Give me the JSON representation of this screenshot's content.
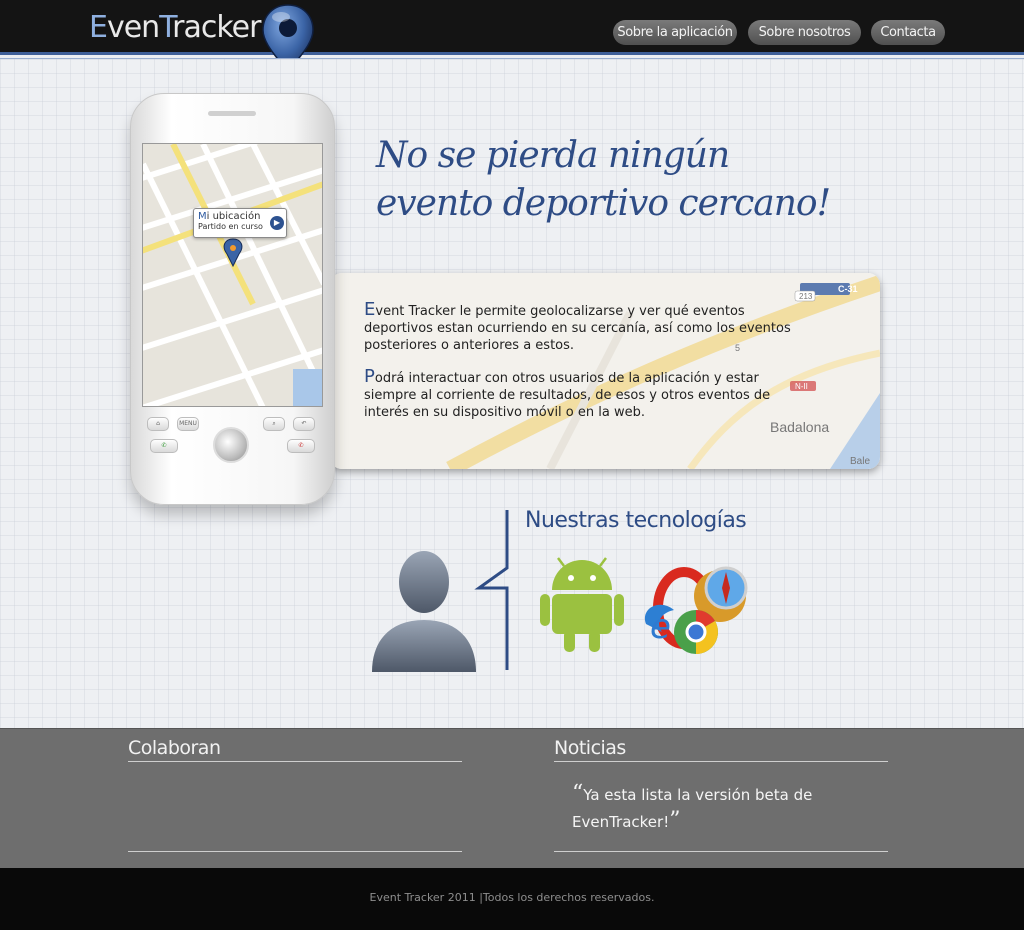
{
  "header": {
    "logo_prefix": "E",
    "logo_mid": "ven",
    "logo_t": "T",
    "logo_suffix": "racker",
    "logo_icon": "map-pin-icon",
    "nav": [
      {
        "label": "Sobre la aplicación"
      },
      {
        "label": "Sobre nosotros"
      },
      {
        "label": "Contacta"
      }
    ]
  },
  "hero": {
    "tagline_line1": "No se pierda ningún",
    "tagline_line2": "evento deportivo cercano!",
    "phone": {
      "callout_first": "M",
      "callout_rest": "i ubicación",
      "callout_sub": "Partido en curso",
      "keys": [
        "home",
        "MENU",
        "search",
        "back",
        "call",
        "end"
      ]
    },
    "info": {
      "p1_cap": "E",
      "p1_rest": "vent Tracker le permite geolocalizarse y ver qué eventos deportivos estan ocurriendo en su cercanía, así como los eventos posteriores o anteriores a estos.",
      "p2_cap": "P",
      "p2_rest": "odrá interactuar con otros usuarios de la aplicación y estar siempre al corriente de resultados, de esos y otros eventos de interés en su dispositivo móvil o en la web.",
      "map_labels": [
        "Badalona",
        "C-31",
        "N-II",
        "213",
        "5",
        "Bale"
      ]
    }
  },
  "tech": {
    "title": "Nuestras tecnologías",
    "icons": [
      "user-silhouette-icon",
      "android-icon",
      "browsers-icon"
    ]
  },
  "footer": {
    "col1_title": "Colaboran",
    "col2_title": "Noticias",
    "quote_open": "“",
    "quote_text": "Ya esta lista la versión beta de EvenTracker!",
    "quote_close": "”",
    "copyright": "Event Tracker 2011  |Todos los derechos reservados."
  },
  "colors": {
    "accent": "#2e4c85",
    "header_bg": "#141414",
    "footer_bg": "#6e6e6e",
    "android_green": "#9bc140"
  }
}
